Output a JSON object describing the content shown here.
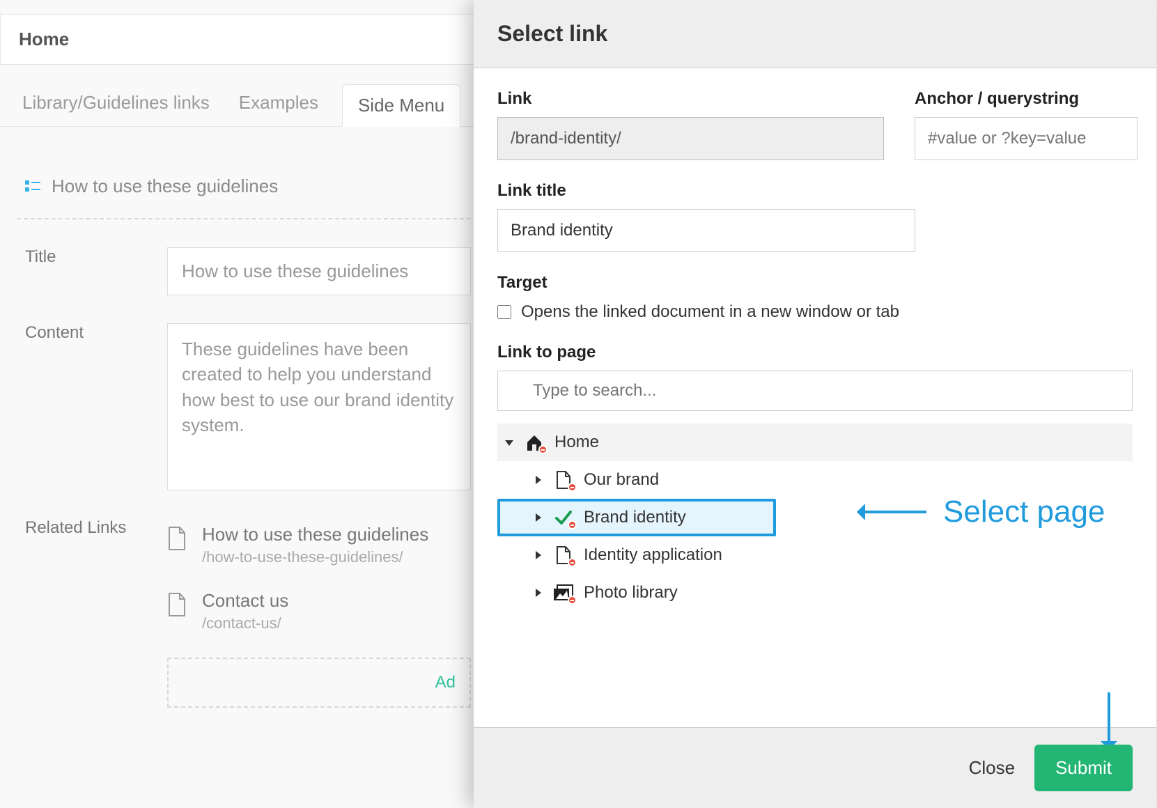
{
  "background": {
    "home_label": "Home",
    "tabs": [
      {
        "label": "Library/Guidelines links"
      },
      {
        "label": "Examples"
      },
      {
        "label": "Side Menu"
      }
    ],
    "section_title": "How to use these guidelines",
    "fields": {
      "title_label": "Title",
      "title_value": "How to use these guidelines",
      "content_label": "Content",
      "content_value": "These guidelines have been created to help you understand how best to use our brand identity system.",
      "related_links_label": "Related Links"
    },
    "related_links": [
      {
        "title": "How to use these guidelines",
        "path": "/how-to-use-these-guidelines/"
      },
      {
        "title": "Contact us",
        "path": "/contact-us/"
      }
    ],
    "add_label": "Ad"
  },
  "modal": {
    "title": "Select link",
    "link_label": "Link",
    "link_value": "/brand-identity/",
    "anchor_label": "Anchor / querystring",
    "anchor_placeholder": "#value or ?key=value",
    "link_title_label": "Link title",
    "link_title_value": "Brand identity",
    "target_label": "Target",
    "target_checkbox_label": "Opens the linked document in a new window or tab",
    "link_to_page_label": "Link to page",
    "search_placeholder": "Type to search...",
    "tree": {
      "root": "Home",
      "children": [
        {
          "label": "Our brand",
          "selected": false,
          "icon": "doc"
        },
        {
          "label": "Brand identity",
          "selected": true,
          "icon": "check"
        },
        {
          "label": "Identity application",
          "selected": false,
          "icon": "doc"
        },
        {
          "label": "Photo library",
          "selected": false,
          "icon": "stack"
        }
      ]
    },
    "close_label": "Close",
    "submit_label": "Submit"
  },
  "annotation": {
    "select_page_label": "Select page"
  }
}
